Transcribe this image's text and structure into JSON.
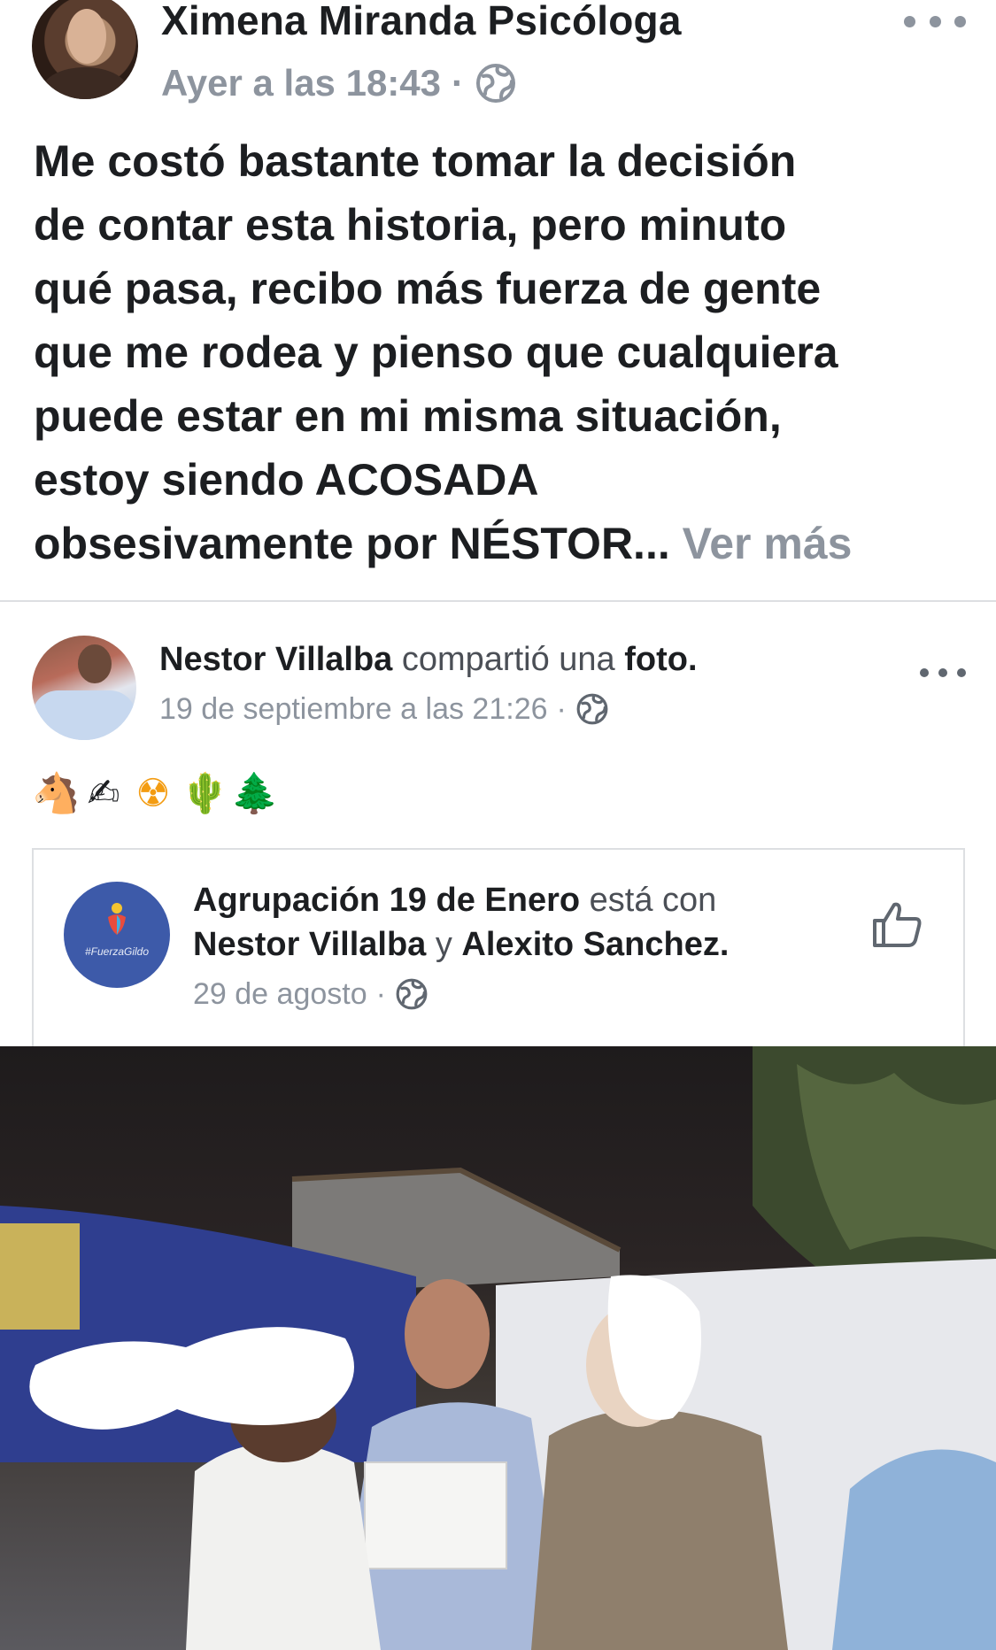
{
  "post": {
    "author": "Ximena Miranda Psicóloga",
    "timestamp": "Ayer a las 18:43",
    "separator": "·",
    "privacy_icon": "globe-icon",
    "text_lines": [
      "Me costó bastante tomar la decisión",
      "de contar esta historia, pero minuto",
      "qué pasa, recibo más fuerza de gente",
      "que me rodea y pienso que cualquiera",
      "puede estar en mi misma situación,",
      "estoy siendo ACOSADA",
      "obsesivamente por NÉSTOR..."
    ],
    "see_more": "Ver más"
  },
  "shared": {
    "author": "Nestor Villalba",
    "action": "compartió una",
    "object": "foto.",
    "timestamp": "19 de septiembre a las 21:26",
    "separator": "·",
    "emojis": [
      "🐴",
      "✍",
      "☢",
      "🌵",
      "🌲"
    ],
    "card": {
      "group": "Agrupación 19 de Enero",
      "with_text": "está con",
      "tagged_1": "Nestor Villalba",
      "conj": "y",
      "tagged_2": "Alexito Sanchez.",
      "date": "29 de agosto",
      "separator": "·",
      "group_tag": "#FuerzaGildo"
    }
  },
  "colors": {
    "text_primary": "#1c1e21",
    "text_secondary": "#8d949e",
    "divider": "#dddfe2",
    "group_avatar": "#3d5aa9"
  }
}
